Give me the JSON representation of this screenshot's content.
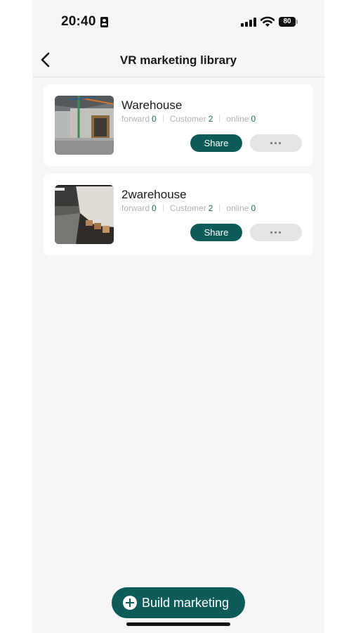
{
  "status_bar": {
    "time": "20:40",
    "battery_level": "80",
    "icons": [
      "id-card-icon",
      "signal-icon",
      "wifi-icon",
      "battery-icon"
    ]
  },
  "nav": {
    "title": "VR marketing library",
    "back_icon": "chevron-left-icon"
  },
  "labels": {
    "forward": "forward",
    "customer": "Customer",
    "online": "online",
    "share": "Share"
  },
  "cards": [
    {
      "title": "Warehouse",
      "forward": "0",
      "customer": "2",
      "online": "0"
    },
    {
      "title": "2warehouse",
      "forward": "0",
      "customer": "2",
      "online": "0"
    }
  ],
  "bottom": {
    "build_label": "Build marketing",
    "build_icon": "plus-circle-icon"
  },
  "colors": {
    "accent": "#0d5c59",
    "count_text": "#1f6f6a",
    "background": "#f6f6f6",
    "card": "#ffffff",
    "more_button": "#e4e4e4"
  }
}
